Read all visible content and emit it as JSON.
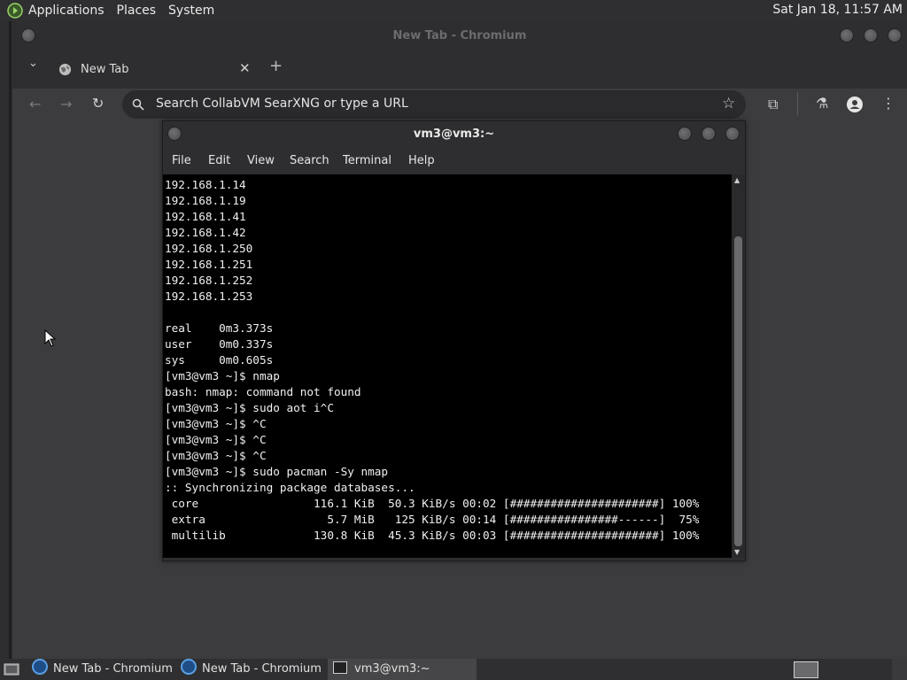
{
  "top_panel": {
    "menus": [
      "Applications",
      "Places",
      "System"
    ],
    "clock": "Sat Jan 18, 11:57 AM"
  },
  "chromium": {
    "window_title": "New Tab - Chromium",
    "tab_label": "New Tab",
    "omnibox_placeholder": "Search CollabVM SearXNG or type a URL"
  },
  "terminal": {
    "title": "vm3@vm3:~",
    "menu": [
      "File",
      "Edit",
      "View",
      "Search",
      "Terminal",
      "Help"
    ],
    "lines": [
      "192.168.1.14",
      "192.168.1.19",
      "192.168.1.41",
      "192.168.1.42",
      "192.168.1.250",
      "192.168.1.251",
      "192.168.1.252",
      "192.168.1.253",
      "",
      "real    0m3.373s",
      "user    0m0.337s",
      "sys     0m0.605s",
      "[vm3@vm3 ~]$ nmap",
      "bash: nmap: command not found",
      "[vm3@vm3 ~]$ sudo aot i^C",
      "[vm3@vm3 ~]$ ^C",
      "[vm3@vm3 ~]$ ^C",
      "[vm3@vm3 ~]$ ^C",
      "[vm3@vm3 ~]$ sudo pacman -Sy nmap",
      ":: Synchronizing package databases...",
      " core                 116.1 KiB  50.3 KiB/s 00:02 [######################] 100%",
      " extra                  5.7 MiB   125 KiB/s 00:14 [################------]  75%",
      " multilib             130.8 KiB  45.3 KiB/s 00:03 [######################] 100%"
    ]
  },
  "taskbar": {
    "tasks": [
      "New Tab - Chromium",
      "New Tab - Chromium",
      "vm3@vm3:~"
    ]
  },
  "colors": {
    "panel": "#2f2f31",
    "terminal_bg": "#000000",
    "accent_globe": "#5aa0e6"
  }
}
